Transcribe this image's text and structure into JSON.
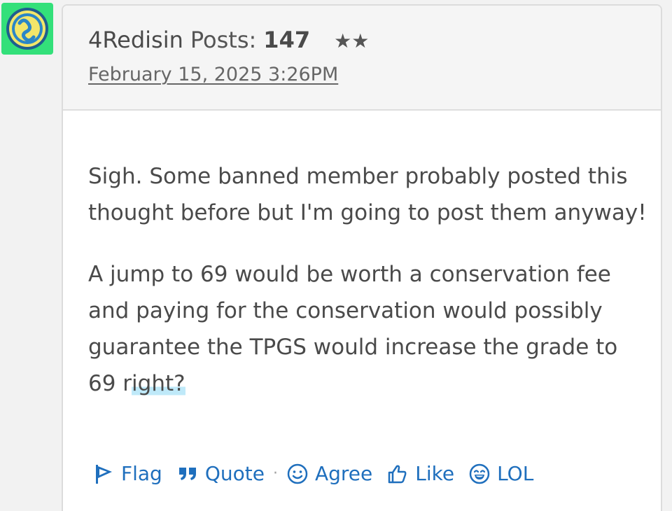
{
  "post": {
    "author": "4Redisin",
    "posts_label": "Posts:",
    "posts_count": "147",
    "stars": "★★",
    "date": "February 15, 2025 3:26PM",
    "paragraphs": [
      "Sigh. Some banned member probably posted this thought before but I'm going to post them anyway!",
      "A jump to 69 would be worth a conservation fee and paying for the conservation would possibly guarantee the TPGS would increase the grade to 69 r"
    ],
    "highlighted_text": "ight?"
  },
  "reactions": {
    "flag": {
      "label": "Flag",
      "icon": "flag-icon"
    },
    "quote": {
      "label": "Quote",
      "icon": "quote-icon"
    },
    "separator": "·",
    "agree": {
      "label": "Agree",
      "icon": "smile-icon"
    },
    "like": {
      "label": "Like",
      "icon": "thumbs-up-icon"
    },
    "lol": {
      "label": "LOL",
      "icon": "laugh-icon"
    }
  },
  "colors": {
    "link": "#1f6fbd",
    "avatar_bg": "#33e07a",
    "text": "#4a4a4a",
    "highlight": "#bfe9f9"
  }
}
